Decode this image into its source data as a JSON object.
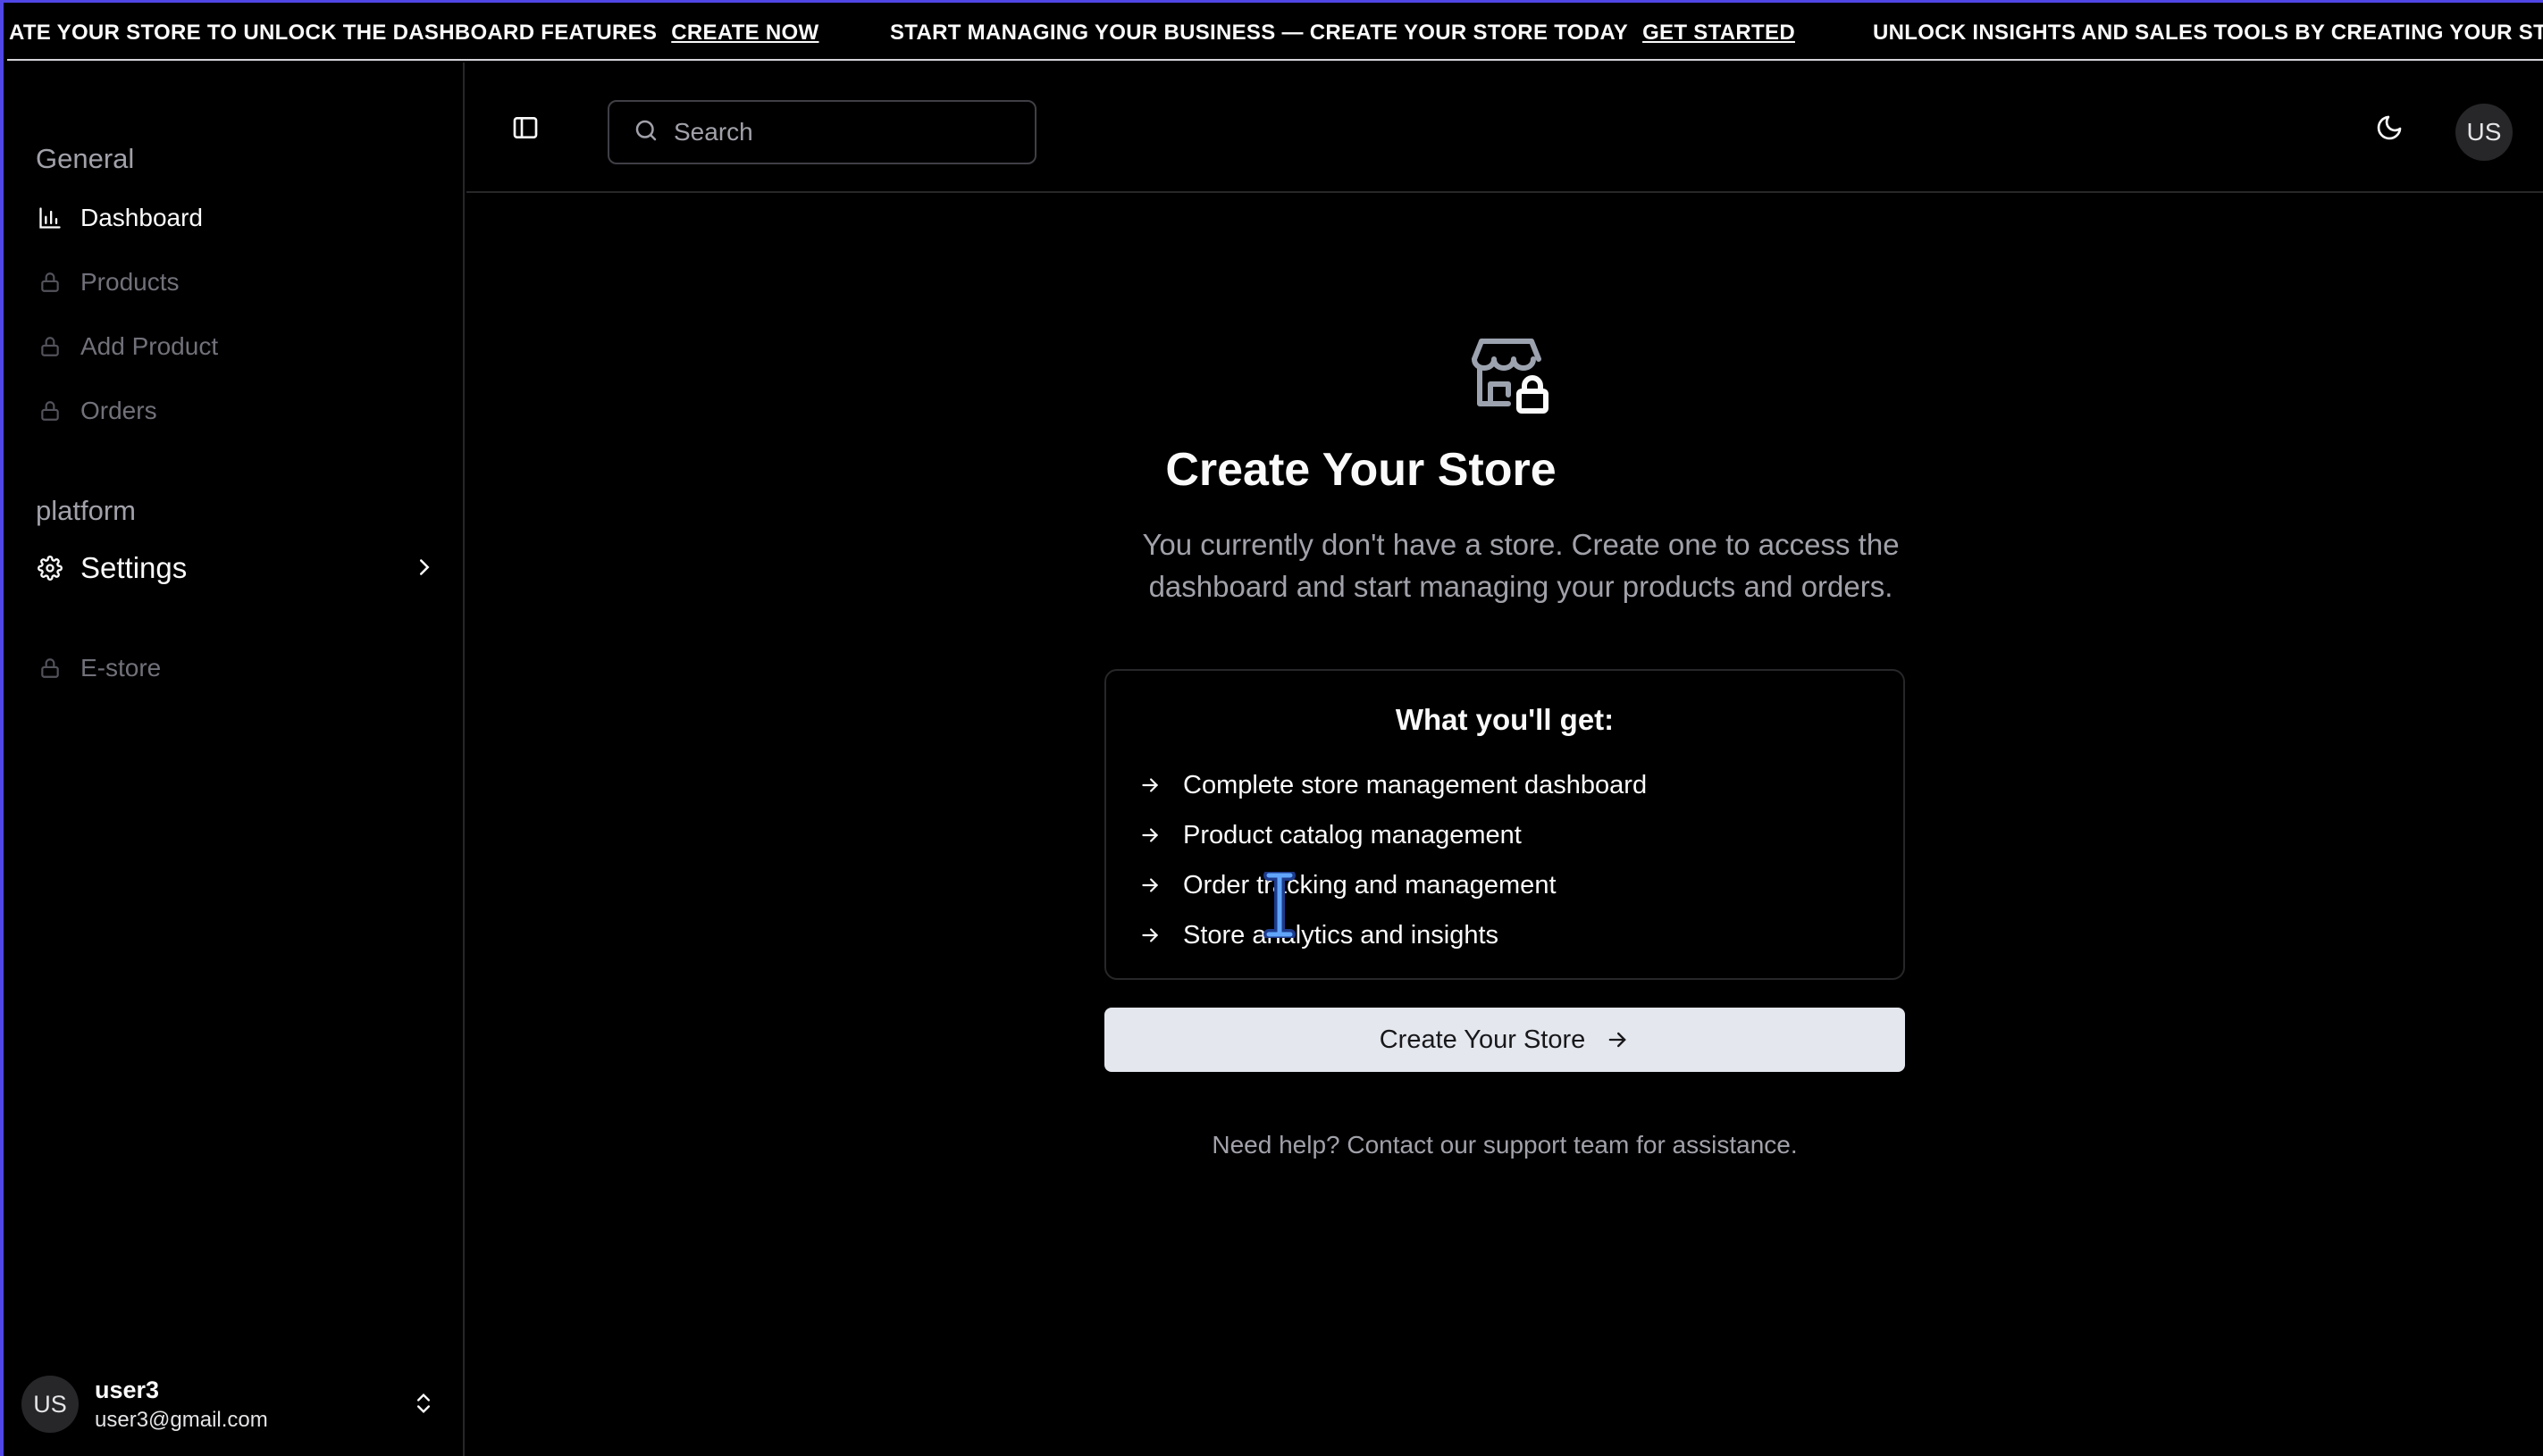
{
  "banner": {
    "items": [
      {
        "message": "ATE YOUR STORE TO UNLOCK THE DASHBOARD FEATURES",
        "cta": "CREATE NOW"
      },
      {
        "message": "START MANAGING YOUR BUSINESS — CREATE YOUR STORE TODAY",
        "cta": "GET STARTED"
      },
      {
        "message": "UNLOCK INSIGHTS AND SALES TOOLS BY CREATING YOUR STOR",
        "cta": ""
      }
    ]
  },
  "sidebar": {
    "general_label": "General",
    "platform_label": "platform",
    "items": [
      {
        "label": "Dashboard",
        "icon": "bar-chart-icon",
        "state": "active"
      },
      {
        "label": "Products",
        "icon": "lock-icon",
        "state": "locked"
      },
      {
        "label": "Add Product",
        "icon": "lock-icon",
        "state": "locked"
      },
      {
        "label": "Orders",
        "icon": "lock-icon",
        "state": "locked"
      }
    ],
    "settings": {
      "label": "Settings",
      "icon": "gear-icon"
    },
    "estore": {
      "label": "E-store",
      "icon": "lock-icon"
    },
    "user": {
      "initials": "US",
      "name": "user3",
      "email": "user3@gmail.com"
    }
  },
  "header": {
    "search_placeholder": "Search",
    "avatar_initials": "US"
  },
  "main": {
    "title": "Create Your Store",
    "description": "You currently don't have a store. Create one to access the dashboard and start managing your products and orders.",
    "features_title": "What you'll get:",
    "features": [
      "Complete store management dashboard",
      "Product catalog management",
      "Order tracking and management",
      "Store analytics and insights"
    ],
    "cta_label": "Create Your Store",
    "help_text": "Need help? Contact our support team for assistance."
  },
  "colors": {
    "background": "#000000",
    "accent_border": "#4f46e5",
    "button_bg": "#e4e7ee",
    "muted_text": "#a1a1aa"
  }
}
